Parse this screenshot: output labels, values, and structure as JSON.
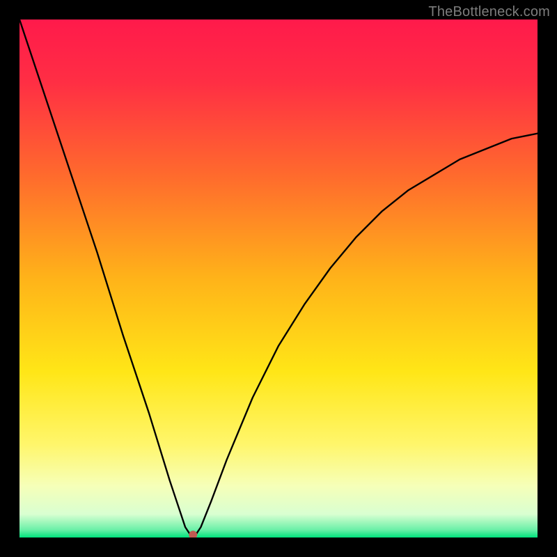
{
  "watermark": "TheBottleneck.com",
  "chart_data": {
    "type": "line",
    "title": "",
    "xlabel": "",
    "ylabel": "",
    "xlim": [
      0,
      100
    ],
    "ylim": [
      0,
      100
    ],
    "grid": false,
    "background_gradient": {
      "stops": [
        {
          "pos": 0.0,
          "color": "#ff1a4b"
        },
        {
          "pos": 0.12,
          "color": "#ff2e44"
        },
        {
          "pos": 0.3,
          "color": "#ff6a2d"
        },
        {
          "pos": 0.5,
          "color": "#ffb319"
        },
        {
          "pos": 0.68,
          "color": "#ffe617"
        },
        {
          "pos": 0.82,
          "color": "#fff66b"
        },
        {
          "pos": 0.9,
          "color": "#f6ffb8"
        },
        {
          "pos": 0.955,
          "color": "#d9ffd1"
        },
        {
          "pos": 0.985,
          "color": "#6bf0a8"
        },
        {
          "pos": 1.0,
          "color": "#00e37d"
        }
      ]
    },
    "curve": {
      "description": "V-shaped bottleneck curve; steep linear descent from top-left to a near-zero minimum around x≈33, then a concave-down rise toward the right edge saturating near y≈78.",
      "x": [
        0,
        5,
        10,
        15,
        20,
        25,
        29,
        31,
        32,
        33,
        34,
        35,
        37,
        40,
        45,
        50,
        55,
        60,
        65,
        70,
        75,
        80,
        85,
        90,
        95,
        100
      ],
      "y": [
        100,
        85,
        70,
        55,
        39,
        24,
        11,
        5,
        2,
        0.5,
        0.5,
        2,
        7,
        15,
        27,
        37,
        45,
        52,
        58,
        63,
        67,
        70,
        73,
        75,
        77,
        78
      ]
    },
    "marker": {
      "x": 33.5,
      "y": 0.5,
      "color": "#c05a52",
      "radius_px": 6
    }
  }
}
